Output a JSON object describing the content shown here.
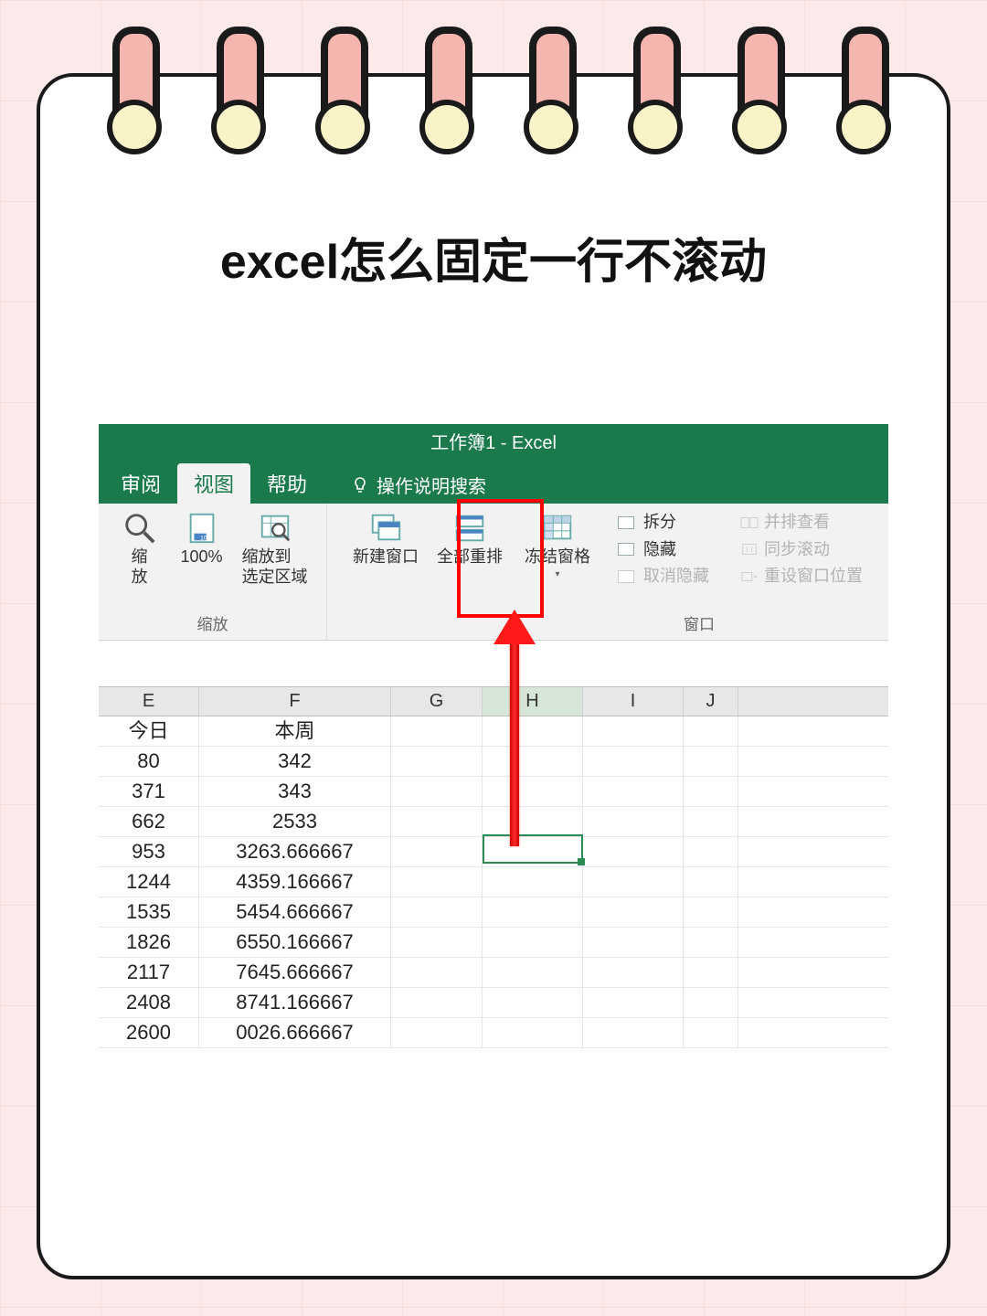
{
  "page_title": "excel怎么固定一行不滚动",
  "window_title": "工作簿1  -  Excel",
  "tabs": {
    "review": "审阅",
    "view": "视图",
    "help": "帮助"
  },
  "tell_me": "操作说明搜索",
  "ribbon": {
    "zoom_group": "缩放",
    "zoom_btn": "缩\n放",
    "zoom_100": "100%",
    "zoom_selection": "缩放到\n选定区域",
    "window_group": "窗口",
    "new_window": "新建窗口",
    "arrange_all": "全部重排",
    "freeze_panes": "冻结窗格",
    "split": "拆分",
    "hide": "隐藏",
    "unhide": "取消隐藏",
    "view_side": "并排查看",
    "sync_scroll": "同步滚动",
    "reset_pos": "重设窗口位置"
  },
  "cols": [
    "E",
    "F",
    "G",
    "H",
    "I",
    "J"
  ],
  "rows": [
    {
      "e": "今日",
      "f": "本周"
    },
    {
      "e": "80",
      "f": "342"
    },
    {
      "e": "371",
      "f": "343"
    },
    {
      "e": "662",
      "f": "2533"
    },
    {
      "e": "953",
      "f": "3263.666667"
    },
    {
      "e": "1244",
      "f": "4359.166667"
    },
    {
      "e": "1535",
      "f": "5454.666667"
    },
    {
      "e": "1826",
      "f": "6550.166667"
    },
    {
      "e": "2117",
      "f": "7645.666667"
    },
    {
      "e": "2408",
      "f": "8741.166667"
    },
    {
      "e": "2600",
      "f": "0026.666667"
    }
  ]
}
